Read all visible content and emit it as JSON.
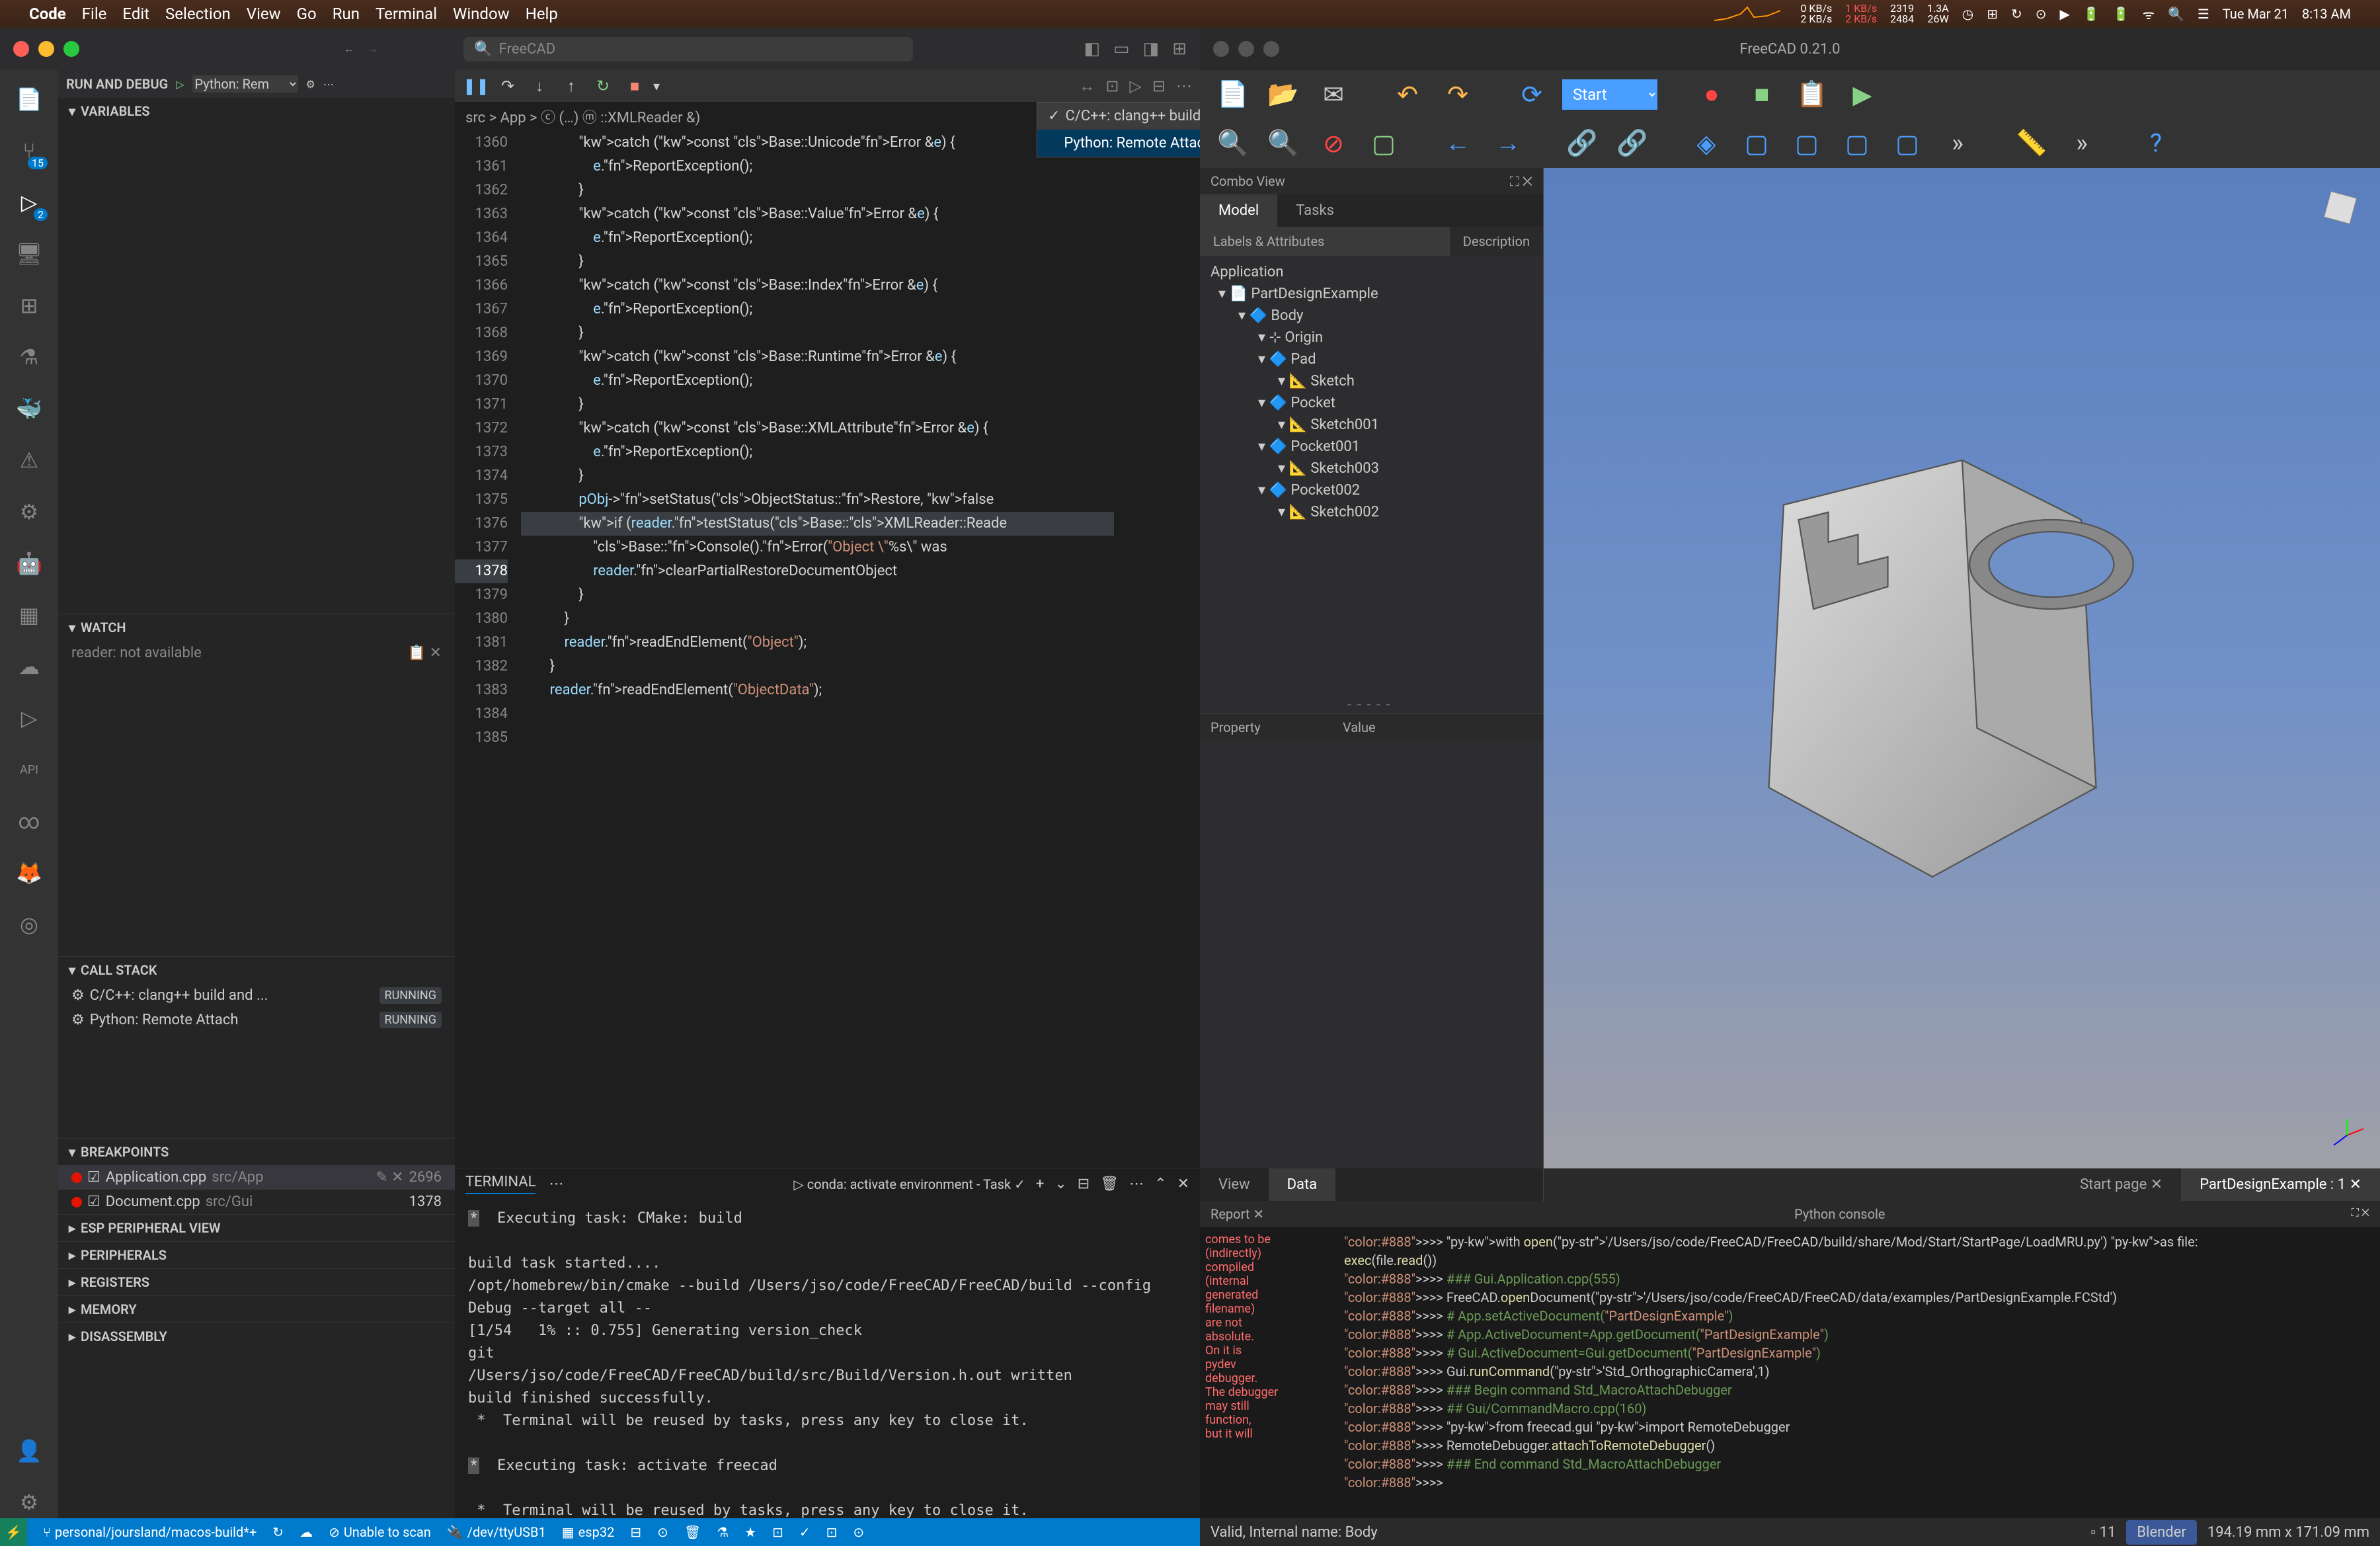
{
  "menubar": {
    "app": "Code",
    "menus": [
      "File",
      "Edit",
      "Selection",
      "View",
      "Go",
      "Run",
      "Terminal",
      "Window",
      "Help"
    ],
    "net_up": "0 KB/s",
    "net_down": "2 KB/s",
    "net_up2": "1 KB/s",
    "net_down2": "2 KB/s",
    "cpu1": "2319",
    "cpu2": "2484",
    "amp": "1.3A",
    "watt": "26W",
    "date": "Tue Mar 21",
    "time": "8:13 AM"
  },
  "vscode": {
    "search_placeholder": "FreeCAD",
    "run_debug_label": "RUN AND DEBUG",
    "config": "Python: Rem",
    "dropdown": {
      "item1": "C/C++: clang++ build and debug FreeCAD",
      "item2": "Python: Remote Attach"
    },
    "breadcrumb": "src > App > ⓒ (…) ⓜ ::XMLReader &)",
    "sections": {
      "variables": "VARIABLES",
      "watch": "WATCH",
      "callstack": "CALL STACK",
      "breakpoints": "BREAKPOINTS",
      "esp": "ESP PERIPHERAL VIEW",
      "peripherals": "PERIPHERALS",
      "registers": "REGISTERS",
      "memory": "MEMORY",
      "disassembly": "DISASSEMBLY"
    },
    "watch_item": "reader: not available",
    "callstack": [
      {
        "name": "C/C++: clang++ build and ...",
        "status": "RUNNING"
      },
      {
        "name": "Python: Remote Attach",
        "status": "RUNNING"
      }
    ],
    "breakpoints": [
      {
        "file": "Application.cpp",
        "path": "src/App",
        "line": "2696"
      },
      {
        "file": "Document.cpp",
        "path": "src/Gui",
        "line": "1378"
      }
    ],
    "code_lines": [
      {
        "n": 1360,
        "t": "                catch (const Base::UnicodeError &e) {"
      },
      {
        "n": 1361,
        "t": "                    e.ReportException();"
      },
      {
        "n": 1362,
        "t": "                }"
      },
      {
        "n": 1363,
        "t": "                catch (const Base::ValueError &e) {"
      },
      {
        "n": 1364,
        "t": "                    e.ReportException();"
      },
      {
        "n": 1365,
        "t": "                }"
      },
      {
        "n": 1366,
        "t": "                catch (const Base::IndexError &e) {"
      },
      {
        "n": 1367,
        "t": "                    e.ReportException();"
      },
      {
        "n": 1368,
        "t": "                }"
      },
      {
        "n": 1369,
        "t": "                catch (const Base::RuntimeError &e) {"
      },
      {
        "n": 1370,
        "t": "                    e.ReportException();"
      },
      {
        "n": 1371,
        "t": "                }"
      },
      {
        "n": 1372,
        "t": "                catch (const Base::XMLAttributeError &e) {"
      },
      {
        "n": 1373,
        "t": "                    e.ReportException();"
      },
      {
        "n": 1374,
        "t": "                }"
      },
      {
        "n": 1375,
        "t": ""
      },
      {
        "n": 1376,
        "t": "                pObj->setStatus(ObjectStatus::Restore, false"
      },
      {
        "n": 1377,
        "t": ""
      },
      {
        "n": 1378,
        "t": "                if (reader.testStatus(Base::XMLReader::Reade"
      },
      {
        "n": 1379,
        "t": "                    Base::Console().Error(\"Object \\\"%s\\\" was"
      },
      {
        "n": 1380,
        "t": "                    reader.clearPartialRestoreDocumentObject"
      },
      {
        "n": 1381,
        "t": "                }"
      },
      {
        "n": 1382,
        "t": "            }"
      },
      {
        "n": 1383,
        "t": "            reader.readEndElement(\"Object\");"
      },
      {
        "n": 1384,
        "t": "        }"
      },
      {
        "n": 1385,
        "t": "        reader.readEndElement(\"ObjectData\");"
      }
    ],
    "terminal": {
      "tab": "TERMINAL",
      "task": "conda: activate environment - Task",
      "lines": [
        "✻  Executing task: CMake: build",
        "",
        "build task started....",
        "/opt/homebrew/bin/cmake --build /Users/jso/code/FreeCAD/FreeCAD/build --config Debug --target all --",
        "[1/54   1% :: 0.755] Generating version_check",
        "git",
        "/Users/jso/code/FreeCAD/FreeCAD/build/src/Build/Version.h.out written",
        "build finished successfully.",
        " *  Terminal will be reused by tasks, press any key to close it.",
        "",
        "✻  Executing task: activate freecad",
        "",
        " *  Terminal will be reused by tasks, press any key to close it."
      ]
    },
    "status": {
      "branch": "personal/joursland/macos-build*+",
      "scan": "Unable to scan",
      "tty": "/dev/ttyUSB1",
      "chip": "esp32"
    }
  },
  "freecad": {
    "title": "FreeCAD 0.21.0",
    "workbench": "Start",
    "combo_view": "Combo View",
    "tabs": {
      "model": "Model",
      "tasks": "Tasks"
    },
    "labels_attrs": "Labels & Attributes",
    "description": "Description",
    "app": "Application",
    "tree": [
      {
        "l": 0,
        "icon": "📄",
        "label": "PartDesignExample"
      },
      {
        "l": 1,
        "icon": "🔷",
        "label": "Body"
      },
      {
        "l": 2,
        "icon": "⊹",
        "label": "Origin"
      },
      {
        "l": 2,
        "icon": "🔷",
        "label": "Pad"
      },
      {
        "l": 3,
        "icon": "📐",
        "label": "Sketch"
      },
      {
        "l": 2,
        "icon": "🔷",
        "label": "Pocket"
      },
      {
        "l": 3,
        "icon": "📐",
        "label": "Sketch001"
      },
      {
        "l": 2,
        "icon": "🔷",
        "label": "Pocket001"
      },
      {
        "l": 3,
        "icon": "📐",
        "label": "Sketch003"
      },
      {
        "l": 2,
        "icon": "🔷",
        "label": "Pocket002"
      },
      {
        "l": 3,
        "icon": "📐",
        "label": "Sketch002"
      }
    ],
    "property": "Property",
    "value": "Value",
    "view_tab": "View",
    "data_tab": "Data",
    "doc_tabs": {
      "start": "Start page",
      "example": "PartDesignExample : 1"
    },
    "report": "Report ✕",
    "python_console": "Python console",
    "report_lines": [
      "comes to be",
      "(indirectly)",
      "compiled",
      "(internal",
      "generated",
      "filename)",
      "are not",
      "absolute.",
      "On it is",
      "pydev",
      "debugger.",
      "The debugger",
      "may still",
      "function,",
      "but it will"
    ],
    "console_lines": [
      ">>> with open('/Users/jso/code/FreeCAD/FreeCAD/build/share/Mod/Start/StartPage/LoadMRU.py') as file:",
      "        exec(file.read())",
      ">>> ### Gui.Application.cpp(555)",
      ">>> FreeCAD.openDocument('/Users/jso/code/FreeCAD/FreeCAD/data/examples/PartDesignExample.FCStd')",
      ">>> # App.setActiveDocument(\"PartDesignExample\")",
      ">>> # App.ActiveDocument=App.getDocument(\"PartDesignExample\")",
      ">>> # Gui.ActiveDocument=Gui.getDocument(\"PartDesignExample\")",
      ">>> Gui.runCommand('Std_OrthographicCamera',1)",
      ">>> ### Begin command Std_MacroAttachDebugger",
      ">>> ## Gui/CommandMacro.cpp(160)",
      ">>> from freecad.gui import RemoteDebugger",
      ">>> RemoteDebugger.attachToRemoteDebugger()",
      ">>> ### End command Std_MacroAttachDebugger",
      ">>> "
    ],
    "status": "Valid, Internal name: Body",
    "pages": "11",
    "blender": "Blender",
    "dims": "194.19 mm x 171.09 mm"
  }
}
